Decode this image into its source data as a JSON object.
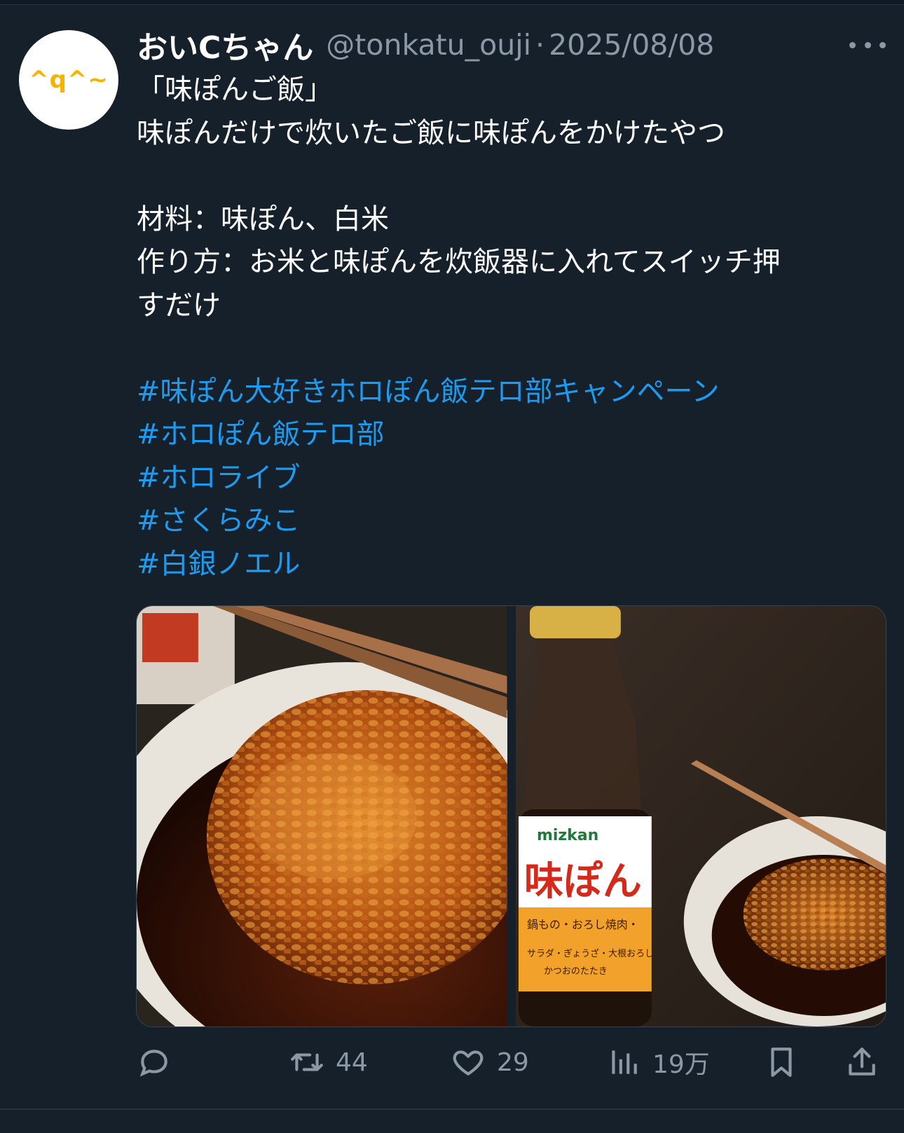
{
  "tweet": {
    "avatar_text": "^q^~",
    "display_name": "おいCちゃん",
    "handle": "@tonkatu_ouji",
    "separator": "·",
    "date": "2025/08/08",
    "lines": [
      "「味ぽんご飯」",
      "味ぽんだけで炊いたご飯に味ぽんをかけたやつ",
      "",
      "材料：味ぽん、白米",
      "作り方：お米と味ぽんを炊飯器に入れてスイッチ押",
      "すだけ",
      ""
    ],
    "hashtags": [
      "#味ぽん大好きホロぽん飯テロ部キャンペーン",
      "#ホロぽん飯テロ部",
      "#ホロライブ",
      "#さくらみこ",
      "#白銀ノエル"
    ],
    "bottle_label": {
      "brand": "mizkan",
      "product": "味ぽん",
      "line1": "鍋もの・おろし焼肉・",
      "line2": "サラダ・ぎょうざ・大根おろし",
      "line3": "かつおのたたき"
    }
  },
  "actions": {
    "reply_icon": "reply-icon",
    "retweet_icon": "retweet-icon",
    "retweet_count": "44",
    "like_icon": "heart-icon",
    "like_count": "29",
    "views_icon": "views-icon",
    "views_count": "19万",
    "bookmark_icon": "bookmark-icon",
    "share_icon": "share-icon"
  },
  "colors": {
    "background": "#15202b",
    "text": "#ffffff",
    "secondary": "#8b98a5",
    "link": "#1d9bf0",
    "avatar_text": "#f4b400"
  }
}
